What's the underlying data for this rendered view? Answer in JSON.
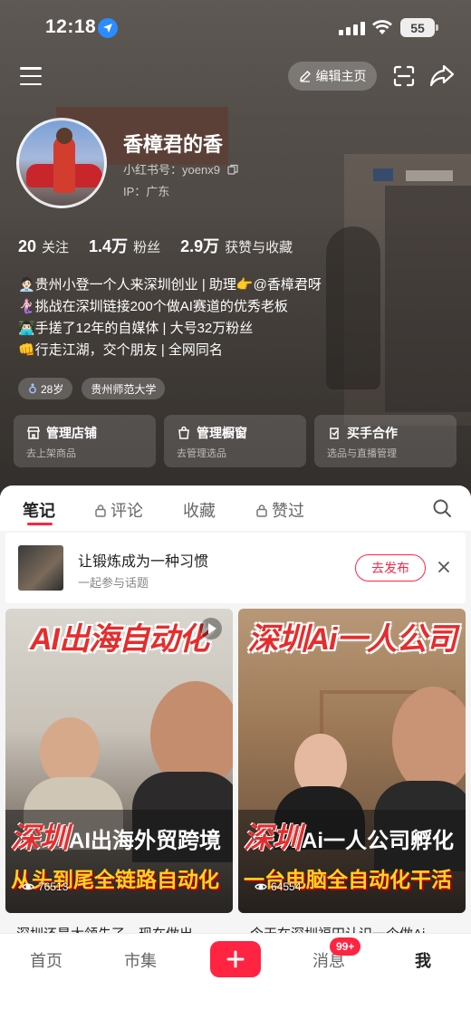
{
  "status": {
    "time": "12:18",
    "battery": "55"
  },
  "topbar": {
    "edit_label": "编辑主页"
  },
  "profile": {
    "nickname": "香樟君的香",
    "redbook_id": "小红书号：yoenx9",
    "ip": "IP：广东",
    "stats": [
      {
        "value": "20",
        "label": "关注"
      },
      {
        "value": "1.4万",
        "label": "粉丝"
      },
      {
        "value": "2.9万",
        "label": "获赞与收藏"
      }
    ],
    "bio": [
      "🧑🏻‍💼贵州小登一个人来深圳创业 | 助理👉@香樟君呀",
      "🧜🏻‍♀️挑战在深圳链接200个做AI赛道的优秀老板",
      "👨🏻‍💻手搓了12年的自媒体 | 大号32万粉丝",
      "👊行走江湖，交个朋友 | 全网同名"
    ],
    "tags": [
      "28岁",
      "贵州师范大学"
    ]
  },
  "tools": [
    {
      "title": "管理店铺",
      "sub": "去上架商品"
    },
    {
      "title": "管理橱窗",
      "sub": "去管理选品"
    },
    {
      "title": "买手合作",
      "sub": "选品与直播管理"
    }
  ],
  "tabs": [
    {
      "label": "笔记"
    },
    {
      "label": "评论"
    },
    {
      "label": "收藏"
    },
    {
      "label": "赞过"
    }
  ],
  "topic": {
    "title": "让锻炼成为一种习惯",
    "sub": "一起参与话题",
    "button": "去发布"
  },
  "notes": [
    {
      "cover_title": "AI出海自动化",
      "line1_red": "深圳",
      "line1_white": "AI出海外贸跨境",
      "line2": "从头到尾全链路自动化",
      "views": "76513",
      "caption": "深圳还是太领先了，现在做出..."
    },
    {
      "cover_title": "深圳Ai一人公司",
      "line1_red": "深圳",
      "line1_white": "Ai一人公司孵化",
      "line2": "一台电脑全自动化干活",
      "views": "64554",
      "caption": "今天在深圳福田认识一个做Ai..."
    }
  ],
  "nav": {
    "home": "首页",
    "market": "市集",
    "messages": "消息",
    "badge": "99+",
    "me": "我"
  },
  "colors": {
    "accent": "#ff2442",
    "location": "#2b8cff"
  }
}
